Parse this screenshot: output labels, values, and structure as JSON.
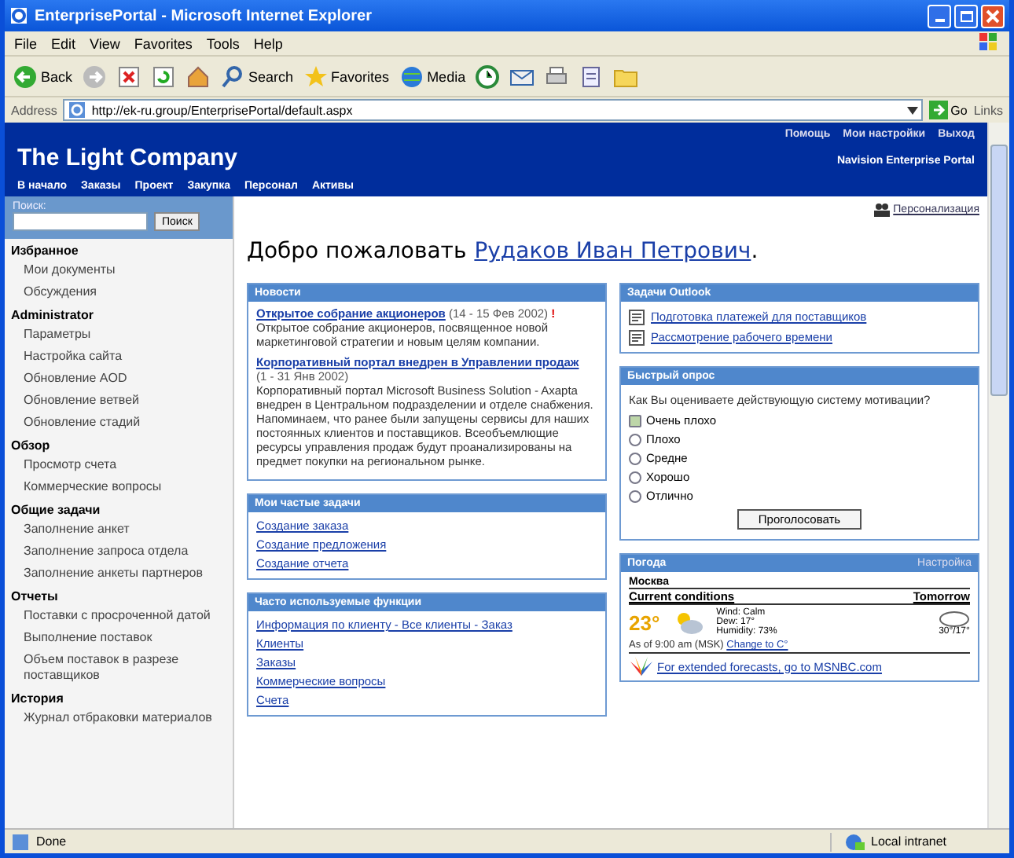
{
  "window": {
    "title": "EnterprisePortal - Microsoft Internet Explorer"
  },
  "menu_bar": [
    "File",
    "Edit",
    "View",
    "Favorites",
    "Tools",
    "Help"
  ],
  "toolbar": [
    {
      "kind": "back",
      "label": "Back"
    },
    {
      "kind": "forward"
    },
    {
      "kind": "stop"
    },
    {
      "kind": "refresh"
    },
    {
      "kind": "home"
    },
    {
      "kind": "search",
      "label": "Search"
    },
    {
      "kind": "favorites",
      "label": "Favorites"
    },
    {
      "kind": "media",
      "label": "Media"
    },
    {
      "kind": "history"
    },
    {
      "kind": "mail"
    },
    {
      "kind": "print"
    },
    {
      "kind": "edit"
    },
    {
      "kind": "folder"
    }
  ],
  "address_bar": {
    "label": "Address",
    "url": "http://ek-ru.group/EnterprisePortal/default.aspx",
    "go": "Go",
    "links": "Links"
  },
  "portal": {
    "company": "The Light Company",
    "top_links": [
      "Помощь",
      "Мои настройки",
      "Выход"
    ],
    "product": "Navision Enterprise Portal",
    "nav": [
      "В начало",
      "Заказы",
      "Проект",
      "Закупка",
      "Персонал",
      "Активы"
    ]
  },
  "sidebar": {
    "search_label": "Поиск:",
    "search_button": "Поиск",
    "groups": [
      {
        "title": "Избранное",
        "items": [
          "Мои документы",
          "Обсуждения"
        ]
      },
      {
        "title": "Administrator",
        "items": [
          "Параметры",
          "Настройка сайта",
          "Обновление AOD",
          "Обновление ветвей",
          "Обновление стадий"
        ]
      },
      {
        "title": "Обзор",
        "items": [
          "Просмотр счета",
          "Коммерческие вопросы"
        ]
      },
      {
        "title": "Общие задачи",
        "items": [
          "Заполнение анкет",
          "Заполнение запроса отдела",
          "Заполнение анкеты партнеров"
        ]
      },
      {
        "title": "Отчеты",
        "items": [
          "Поставки с просроченной датой",
          "Выполнение поставок",
          "Объем поставок в разрезе поставщиков"
        ]
      },
      {
        "title": "История",
        "items": [
          "Журнал отбраковки материалов"
        ]
      }
    ]
  },
  "personalize": "Персонализация",
  "welcome": {
    "text": "Добро пожаловать",
    "user": "Рудаков Иван Петрович",
    "end": "."
  },
  "news": {
    "title": "Новости",
    "items": [
      {
        "title": "Открытое собрание акционеров",
        "date": "(14 - 15 Фев 2002)",
        "flag": "!",
        "body": "Открытое собрание акционеров, посвященное новой маркетинговой стратегии и новым целям компании."
      },
      {
        "title": "Корпоративный портал внедрен в Управлении продаж",
        "date": "(1 - 31 Янв 2002)",
        "body": "Корпоративный портал Microsoft Business Solution - Axapta внедрен в Центральном подразделении и отделе снабжения. Напоминаем, что ранее были запущены сервисы для наших постоянных клиентов и поставщиков. Всеобъемлющие ресурсы управления продаж будут проанализированы на предмет покупки на региональном рынке."
      }
    ]
  },
  "tasks": {
    "title": "Мои частые задачи",
    "items": [
      "Создание заказа",
      "Создание предложения",
      "Создание отчета"
    ]
  },
  "functions": {
    "title": "Часто используемые функции",
    "items": [
      "Информация по клиенту - Все клиенты - Заказ",
      "Клиенты",
      "Заказы",
      "Коммерческие вопросы",
      "Счета"
    ]
  },
  "outlook": {
    "title": "Задачи Outlook",
    "items": [
      "Подготовка платежей для поставщиков",
      "Рассмотрение рабочего времени"
    ]
  },
  "poll": {
    "title": "Быстрый опрос",
    "question": "Как Вы оцениваете действующую систему мотивации?",
    "options": [
      {
        "label": "Очень плохо",
        "selected": true
      },
      {
        "label": "Плохо",
        "selected": false
      },
      {
        "label": "Средне",
        "selected": false
      },
      {
        "label": "Хорошо",
        "selected": false
      },
      {
        "label": "Отлично",
        "selected": false
      }
    ],
    "button": "Проголосовать"
  },
  "weather": {
    "title": "Погода",
    "settings": "Настройка",
    "city": "Москва",
    "current": "Current conditions",
    "tomorrow": "Tomorrow",
    "temp": "23°",
    "details": [
      "Wind: Calm",
      "Dew: 17°",
      "Humidity: 73%"
    ],
    "forecast": "30°/17°",
    "updated": "As of 9:00 am (MSK)",
    "change": "Change to C°",
    "footer": "For extended forecasts, go to MSNBC.com"
  },
  "status_bar": {
    "text": "Done",
    "zone": "Local intranet"
  }
}
